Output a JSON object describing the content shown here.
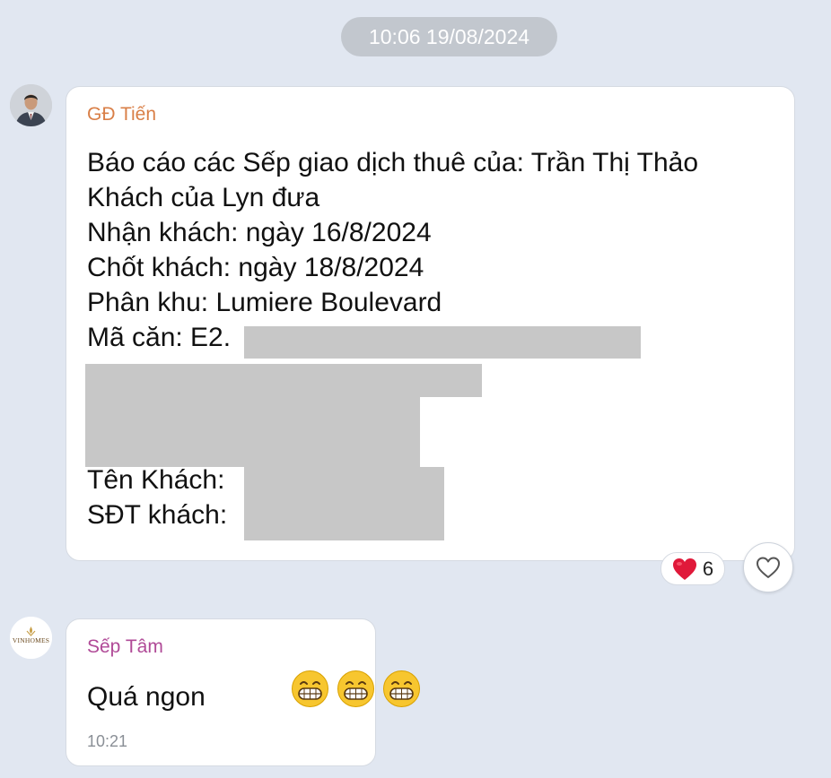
{
  "date_separator": "10:06 19/08/2024",
  "message1": {
    "sender": "GĐ Tiến",
    "lines": [
      "Báo cáo các Sếp giao dịch thuê của: Trần Thị Thảo",
      "Khách của Lyn đưa",
      "Nhận khách: ngày 16/8/2024",
      "Chốt khách: ngày 18/8/2024",
      "Phân khu: Lumiere Boulevard",
      "Mã căn: E2.",
      "Tên Khách:",
      "SĐT khách:"
    ],
    "reaction": {
      "icon": "heart-icon",
      "count": "6"
    }
  },
  "message2": {
    "sender": "Sếp Tâm",
    "text": "Quá ngon",
    "emoji_icons": [
      "grinning-face-icon",
      "grinning-face-icon",
      "grinning-face-icon"
    ],
    "time": "10:21",
    "avatar_logo_text": "VINHOMES"
  },
  "colors": {
    "background": "#e1e7f1",
    "sender1": "#d97f47",
    "sender2": "#b04a97",
    "redaction": "#c7c7c7",
    "heart": "#e0193a"
  }
}
